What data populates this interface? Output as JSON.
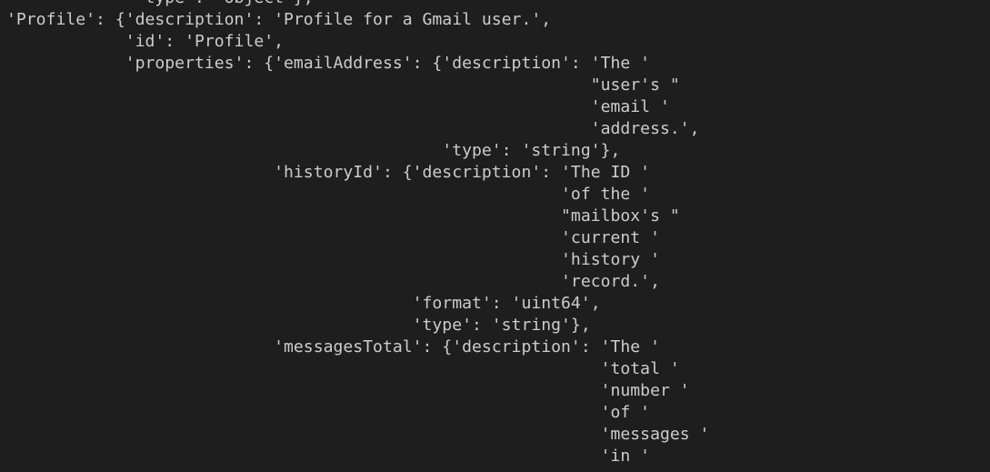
{
  "terminal": {
    "lines": [
      "             'type': 'object'},",
      "'Profile': {'description': 'Profile for a Gmail user.',",
      "            'id': 'Profile',",
      "            'properties': {'emailAddress': {'description': 'The '",
      "                                                           \"user's \"",
      "                                                           'email '",
      "                                                           'address.',",
      "                                            'type': 'string'},",
      "                           'historyId': {'description': 'The ID '",
      "                                                        'of the '",
      "                                                        \"mailbox's \"",
      "                                                        'current '",
      "                                                        'history '",
      "                                                        'record.',",
      "                                         'format': 'uint64',",
      "                                         'type': 'string'},",
      "                           'messagesTotal': {'description': 'The '",
      "                                                            'total '",
      "                                                            'number '",
      "                                                            'of '",
      "                                                            'messages '",
      "                                                            'in '"
    ]
  }
}
